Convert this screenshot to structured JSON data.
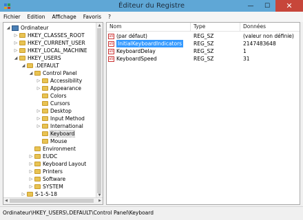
{
  "window": {
    "title": "Éditeur du Registre",
    "minimize": "—",
    "maximize": "☐",
    "close": "✕"
  },
  "menu": [
    "Fichier",
    "Edition",
    "Affichage",
    "Favoris",
    "?"
  ],
  "tree": [
    {
      "label": "Ordinateur",
      "level": 0,
      "toggle": "◢",
      "icon": "computer-icon"
    },
    {
      "label": "HKEY_CLASSES_ROOT",
      "level": 1,
      "toggle": "▷",
      "icon": "folder-icon"
    },
    {
      "label": "HKEY_CURRENT_USER",
      "level": 1,
      "toggle": "▷",
      "icon": "folder-icon"
    },
    {
      "label": "HKEY_LOCAL_MACHINE",
      "level": 1,
      "toggle": "▷",
      "icon": "folder-icon"
    },
    {
      "label": "HKEY_USERS",
      "level": 1,
      "toggle": "◢",
      "icon": "folder-icon"
    },
    {
      "label": ".DEFAULT",
      "level": 2,
      "toggle": "◢",
      "icon": "folder-icon"
    },
    {
      "label": "Control Panel",
      "level": 3,
      "toggle": "◢",
      "icon": "folder-icon"
    },
    {
      "label": "Accessibility",
      "level": 4,
      "toggle": "▷",
      "icon": "folder-icon"
    },
    {
      "label": "Appearance",
      "level": 4,
      "toggle": "▷",
      "icon": "folder-icon"
    },
    {
      "label": "Colors",
      "level": 4,
      "toggle": "",
      "icon": "folder-icon"
    },
    {
      "label": "Cursors",
      "level": 4,
      "toggle": "",
      "icon": "folder-icon"
    },
    {
      "label": "Desktop",
      "level": 4,
      "toggle": "▷",
      "icon": "folder-icon"
    },
    {
      "label": "Input Method",
      "level": 4,
      "toggle": "▷",
      "icon": "folder-icon"
    },
    {
      "label": "International",
      "level": 4,
      "toggle": "▷",
      "icon": "folder-icon"
    },
    {
      "label": "Keyboard",
      "level": 4,
      "toggle": "",
      "icon": "folder-icon",
      "selected": true
    },
    {
      "label": "Mouse",
      "level": 4,
      "toggle": "",
      "icon": "folder-icon"
    },
    {
      "label": "Environment",
      "level": 3,
      "toggle": "",
      "icon": "folder-icon"
    },
    {
      "label": "EUDC",
      "level": 3,
      "toggle": "▷",
      "icon": "folder-icon"
    },
    {
      "label": "Keyboard Layout",
      "level": 3,
      "toggle": "▷",
      "icon": "folder-icon"
    },
    {
      "label": "Printers",
      "level": 3,
      "toggle": "▷",
      "icon": "folder-icon"
    },
    {
      "label": "Software",
      "level": 3,
      "toggle": "▷",
      "icon": "folder-icon"
    },
    {
      "label": "SYSTEM",
      "level": 3,
      "toggle": "▷",
      "icon": "folder-icon"
    },
    {
      "label": "S-1-5-18",
      "level": 2,
      "toggle": "▷",
      "icon": "folder-icon"
    },
    {
      "label": "S-1-5-19",
      "level": 2,
      "toggle": "▷",
      "icon": "folder-icon"
    }
  ],
  "table": {
    "headers": {
      "name": "Nom",
      "type": "Type",
      "data": "Données"
    },
    "rows": [
      {
        "name": "(par défaut)",
        "type": "REG_SZ",
        "data": "(valeur non définie)"
      },
      {
        "name": "InitialKeyboardIndicators",
        "type": "REG_SZ",
        "data": "2147483648",
        "selected": true
      },
      {
        "name": "KeyboardDelay",
        "type": "REG_SZ",
        "data": "1"
      },
      {
        "name": "KeyboardSpeed",
        "type": "REG_SZ",
        "data": "31"
      }
    ]
  },
  "status": "Ordinateur\\HKEY_USERS\\.DEFAULT\\Control Panel\\Keyboard",
  "colors": {
    "titlebar": "#5fa7d6",
    "close": "#c7463a",
    "selection": "#3399ff",
    "folder": "#e8c353"
  }
}
